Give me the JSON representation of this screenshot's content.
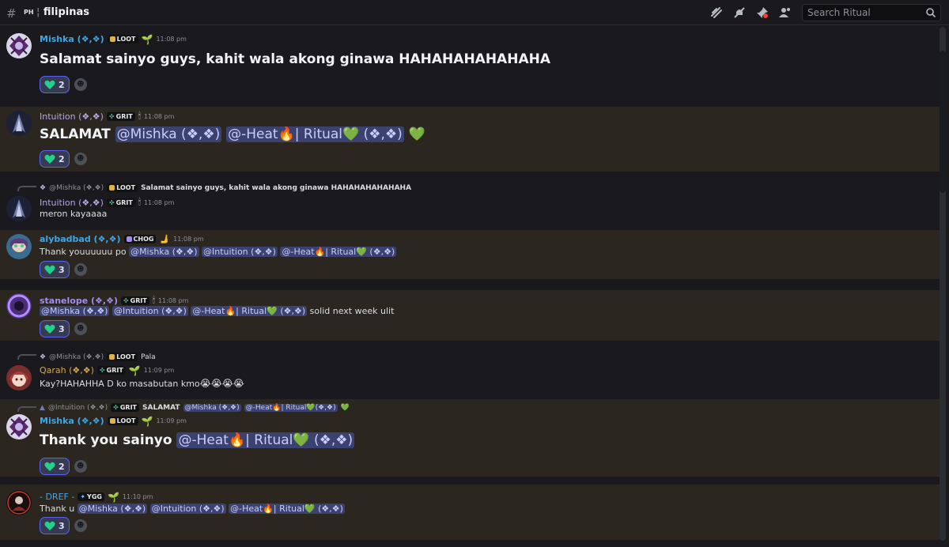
{
  "channel": {
    "prefix": "PH",
    "separator": "¦",
    "name": "filipinas"
  },
  "header_icons": [
    "threads-icon",
    "mute-icon",
    "pin-icon",
    "members-icon"
  ],
  "search": {
    "placeholder": "Search Ritual"
  },
  "colors": {
    "accent": "#5865f2",
    "highlight_bg": "#2b2620",
    "heart": "#23d18b"
  },
  "messages": [
    {
      "author": "Mishka (❖,❖)",
      "author_color": "#3fa6e8",
      "badge": "LOOT",
      "badge_icon": "loot",
      "extra": "sprout",
      "time": "11:08 pm",
      "text": "Salamat sainyo guys, kahit wala akong ginawa HAHAHAHAHAHAHA",
      "reaction_count": "2"
    },
    {
      "author": "Intuition (❖,❖)",
      "author_color": "#b9a6e6",
      "badge": "GRIT",
      "badge_icon": "grit",
      "extra": "candle",
      "time": "11:08 pm",
      "text_prefix": "SALAMAT",
      "mentions": [
        "@Mishka (❖,❖)",
        "@-Heat",
        "| Ritual",
        "(❖,❖)"
      ],
      "reaction_count": "2"
    },
    {
      "reply": {
        "author": "@Mishka (❖,❖)",
        "badge": "LOOT",
        "text": "Salamat sainyo guys, kahit wala akong ginawa HAHAHAHAHAHAHA"
      },
      "author": "Intuition (❖,❖)",
      "badge": "GRIT",
      "time": "11:08 pm",
      "text": "meron kayaaaa"
    },
    {
      "author": "alybadbad (❖,❖)",
      "author_color": "#3fa6e8",
      "badge": "CHOG",
      "time": "11:08 pm",
      "text_prefix": "Thank youuuuuu po",
      "mentions": [
        "@Mishka (❖,❖)",
        "@Intuition (❖,❖)",
        "@-Heat",
        "| Ritual",
        "(❖,❖)"
      ],
      "reaction_count": "3"
    },
    {
      "author": "stanelope (❖,❖)",
      "author_color": "#a58cf0",
      "badge": "GRIT",
      "time": "11:08 pm",
      "mentions": [
        "@Mishka (❖,❖)",
        "@Intuition (❖,❖)",
        "@-Heat",
        "| Ritual",
        "(❖,❖)"
      ],
      "text_suffix": "solid next week ulit",
      "reaction_count": "3"
    },
    {
      "reply": {
        "author": "@Mishka (❖,❖)",
        "badge": "LOOT",
        "text": "Pala"
      },
      "author": "Qarah (❖,❖)",
      "author_color": "#d4a84f",
      "badge": "GRIT",
      "time": "11:09 pm",
      "text": "Kay?HAHAHHA D ko masabutan kmo"
    },
    {
      "reply": {
        "author": "@Intuition (❖,❖)",
        "badge": "GRIT",
        "text_prefix": "SALAMAT",
        "mentions": [
          "@Mishka (❖,❖)",
          "@-Heat",
          "| Ritual",
          "(❖,❖)"
        ]
      },
      "author": "Mishka (❖,❖)",
      "badge": "LOOT",
      "time": "11:09 pm",
      "text_prefix": "Thank you sainyo",
      "mentions": [
        "@-Heat",
        "| Ritual",
        "(❖,❖)"
      ],
      "reaction_count": "2"
    },
    {
      "author": "- DREF -",
      "author_color": "#3fa6e8",
      "badge": "YGG",
      "time": "11:10 pm",
      "text_prefix": "Thank u",
      "mentions": [
        "@Mishka (❖,❖)",
        "@Intuition (❖,❖)",
        "@-Heat",
        "| Ritual",
        "(❖,❖)"
      ],
      "reaction_count": "3"
    }
  ]
}
